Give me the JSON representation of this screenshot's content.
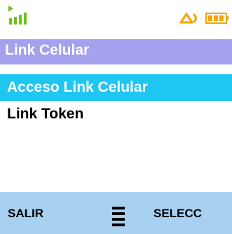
{
  "status_bar": {
    "signal_icon": "signal-strength-icon",
    "alert_icon": "network-alert-icon",
    "battery_icon": "battery-icon"
  },
  "header": {
    "title": "Link Celular"
  },
  "menu": {
    "items": [
      {
        "label": "Acceso Link Celular",
        "selected": true
      },
      {
        "label": "Link Token",
        "selected": false
      }
    ]
  },
  "softkeys": {
    "left_label": "SALIR",
    "center_icon": "menu-icon",
    "right_label": "SELECC"
  },
  "colors": {
    "title_bar": "#a5a1ee",
    "selected_item": "#20c6f2",
    "softkey_bar": "#a7d0f1",
    "signal_green": "#6dc21e",
    "battery_orange": "#f5a400"
  }
}
